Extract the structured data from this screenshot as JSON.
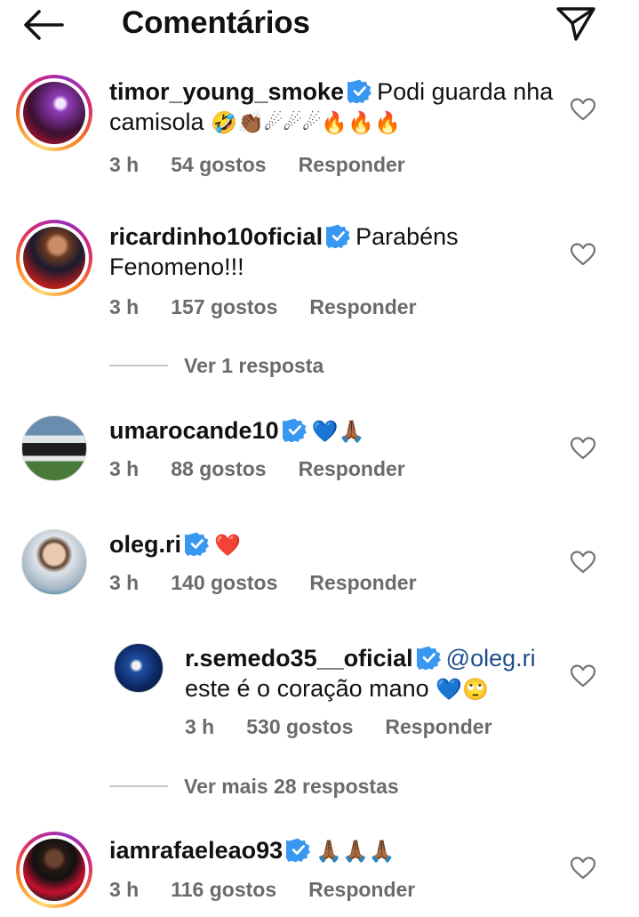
{
  "header": {
    "title": "Comentários"
  },
  "comments": [
    {
      "username": "timor_young_smoke",
      "text": "Podi guarda nha camisola",
      "emojis": "🤣👏🏾☄☄☄🔥🔥🔥",
      "time": "3 h",
      "likes": "54 gostos",
      "reply_label": "Responder"
    },
    {
      "username": "ricardinho10oficial",
      "text": "Parabéns Fenomeno!!!",
      "time": "3 h",
      "likes": "157 gostos",
      "reply_label": "Responder",
      "view_replies": "Ver 1 resposta"
    },
    {
      "username": "umarocande10",
      "text": "",
      "emojis": "💙🙏🏾",
      "time": "3 h",
      "likes": "88 gostos",
      "reply_label": "Responder"
    },
    {
      "username": "oleg.ri",
      "text": "",
      "emojis": "❤️",
      "time": "3 h",
      "likes": "140 gostos",
      "reply_label": "Responder"
    },
    {
      "username": "iamrafaeleao93",
      "text": "",
      "emojis": "🙏🏾🙏🏾🙏🏾",
      "time": "3 h",
      "likes": "116 gostos",
      "reply_label": "Responder"
    }
  ],
  "reply": {
    "username": "r.semedo35__oficial",
    "mention": "@oleg.ri",
    "text": "este é o coração mano",
    "emojis": "💙🙄",
    "time": "3 h",
    "likes": "530 gostos",
    "reply_label": "Responder"
  },
  "view_more_replies": "Ver mais 28 respostas",
  "icons": {
    "back": "arrow-left-icon",
    "send": "paper-plane-icon",
    "like": "heart-outline-icon",
    "verified": "verified-badge-icon"
  },
  "colors": {
    "verified": "#3897f0",
    "meta_text": "#6b6b6b",
    "mention": "#1d4e89"
  }
}
